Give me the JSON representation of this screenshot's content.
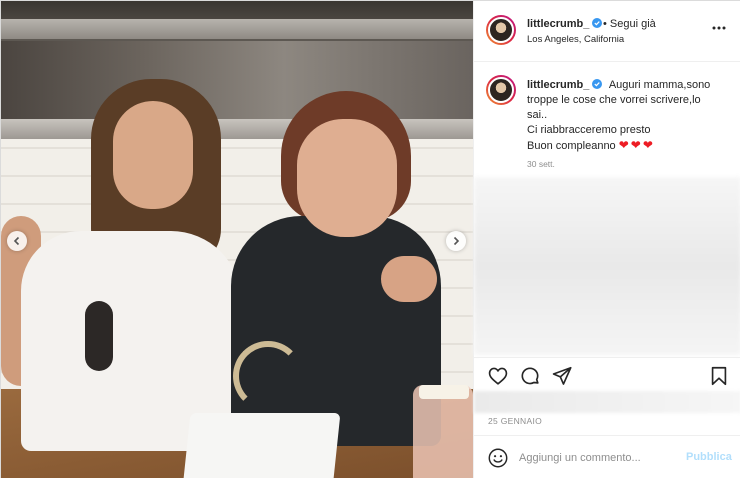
{
  "post": {
    "username": "littlecrumb_",
    "follow_status": "• Segui già",
    "location": "Los Angeles, California",
    "caption": {
      "line1": "Auguri mamma,sono",
      "line2": "troppe le cose che vorrei scrivere,lo",
      "line3": "sai..",
      "line4": "Ci riabbracceremo presto",
      "line5": "Buon compleanno",
      "hearts": "❤❤❤"
    },
    "caption_time": "30 sett.",
    "date": "25 GENNAIO",
    "comment": {
      "placeholder": "Aggiungi un commento...",
      "publish_label": "Pubblica"
    }
  },
  "colors": {
    "verified": "#3897f0",
    "publish_disabled": "#b2dffc",
    "heart": "#ed1c24"
  },
  "icons": {
    "like": "heart-icon",
    "comment": "comment-icon",
    "share": "share-icon",
    "save": "bookmark-icon",
    "more": "more-options-icon",
    "emoji": "emoji-icon",
    "prev": "chevron-left-icon",
    "next": "chevron-right-icon"
  }
}
